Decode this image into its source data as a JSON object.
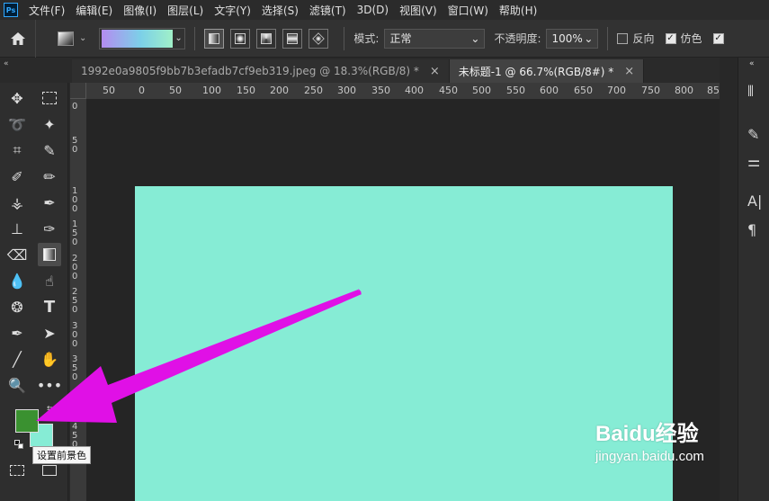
{
  "app": {
    "logo": "Ps"
  },
  "menu": [
    "文件(F)",
    "编辑(E)",
    "图像(I)",
    "图层(L)",
    "文字(Y)",
    "选择(S)",
    "滤镜(T)",
    "3D(D)",
    "视图(V)",
    "窗口(W)",
    "帮助(H)"
  ],
  "options": {
    "mode_label": "模式:",
    "mode_value": "正常",
    "opacity_label": "不透明度:",
    "opacity_value": "100%",
    "reverse_label": "反向",
    "reverse_checked": false,
    "dither_label": "仿色",
    "dither_checked": true,
    "transparency_checked": true
  },
  "tabs": [
    {
      "label": "1992e0a9805f9bb7b3efadb7cf9eb319.jpeg @ 18.3%(RGB/8) *",
      "active": false
    },
    {
      "label": "未标题-1 @ 66.7%(RGB/8#) *",
      "active": true
    }
  ],
  "ruler": {
    "top_ticks": [
      "50",
      "0",
      "50",
      "100",
      "150",
      "200",
      "250",
      "300",
      "350",
      "400",
      "450",
      "500",
      "550",
      "600",
      "650",
      "700",
      "750",
      "800",
      "85"
    ],
    "left_ticks": [
      "0",
      "50",
      "100",
      "150",
      "200",
      "250",
      "300",
      "350",
      "400",
      "450"
    ]
  },
  "colors": {
    "foreground": "#3a9130",
    "background": "#86ecd5",
    "canvas": "#86ecd5",
    "arrow": "#e010e6"
  },
  "tooltip": "设置前景色",
  "watermark": {
    "brand": "Baidu经验",
    "url": "jingyan.baidu.com"
  }
}
